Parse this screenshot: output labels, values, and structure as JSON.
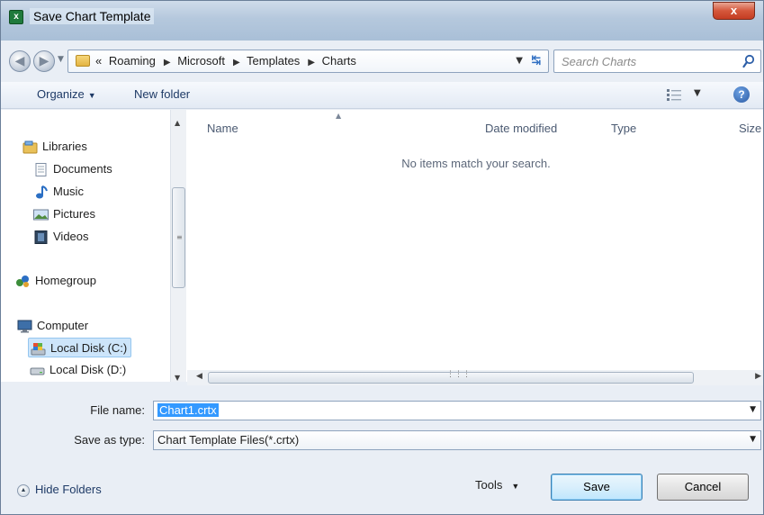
{
  "window": {
    "title": "Save Chart Template",
    "app_icon_glyph": "x",
    "close_glyph": "x"
  },
  "address": {
    "overflow_glyph": "«",
    "crumbs": [
      "Roaming",
      "Microsoft",
      "Templates",
      "Charts"
    ]
  },
  "search": {
    "placeholder": "Search Charts"
  },
  "toolbar": {
    "organize_label": "Organize",
    "new_folder_label": "New folder"
  },
  "nav_pane": {
    "items": [
      {
        "label": "Libraries",
        "icon": "libraries-icon"
      },
      {
        "label": "Documents",
        "icon": "documents-icon"
      },
      {
        "label": "Music",
        "icon": "music-icon"
      },
      {
        "label": "Pictures",
        "icon": "pictures-icon"
      },
      {
        "label": "Videos",
        "icon": "videos-icon"
      },
      {
        "label": "Homegroup",
        "icon": "homegroup-icon"
      },
      {
        "label": "Computer",
        "icon": "computer-icon"
      },
      {
        "label": "Local Disk (C:)",
        "icon": "local-disk-icon",
        "selected": true
      },
      {
        "label": "Local Disk (D:)",
        "icon": "drive-icon"
      }
    ]
  },
  "file_list": {
    "columns": [
      "Name",
      "Date modified",
      "Type",
      "Size"
    ],
    "empty_message": "No items match your search."
  },
  "form": {
    "file_name_label": "File name:",
    "file_name_value": "Chart1.crtx",
    "save_as_type_label": "Save as type:",
    "save_as_type_value": "Chart Template Files(*.crtx)"
  },
  "footer": {
    "hide_folders_label": "Hide Folders",
    "tools_label": "Tools",
    "save_label": "Save",
    "cancel_label": "Cancel"
  },
  "colors": {
    "selection": "#3399ff",
    "link_text": "#1e3a66",
    "close_button": "#c43d23"
  }
}
